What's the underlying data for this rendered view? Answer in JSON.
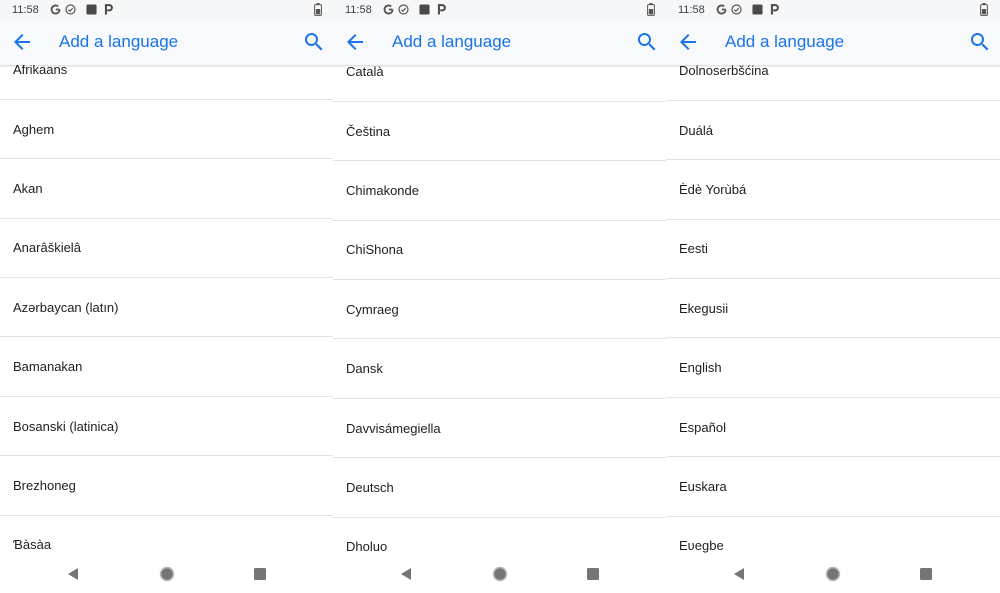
{
  "colors": {
    "accent": "#1a73e8",
    "text": "#202124",
    "icon_gray": "#757575",
    "divider": "#e3e3e3"
  },
  "screens": [
    {
      "status_bar": {
        "time": "11:58",
        "icons": [
          "google-icon",
          "circle-check-icon",
          "square-notification-icon",
          "p-icon"
        ],
        "battery": "battery-icon"
      },
      "app_bar": {
        "back_icon": "arrow-left-icon",
        "title": "Add a language",
        "search_icon": "search-icon"
      },
      "languages": [
        "Afrikaans",
        "Aghem",
        "Akan",
        "Anarâškielâ",
        "Azərbaycan (latın)",
        "Bamanakan",
        "Bosanski (latinica)",
        "Brezhoneg",
        "Ɓàsàa"
      ],
      "nav_bar": {
        "icons": [
          "back-triangle-icon",
          "home-circle-icon",
          "recents-square-icon"
        ]
      }
    },
    {
      "status_bar": {
        "time": "11:58",
        "icons": [
          "google-icon",
          "circle-check-icon",
          "square-notification-icon",
          "p-icon"
        ],
        "battery": "battery-icon"
      },
      "app_bar": {
        "back_icon": "arrow-left-icon",
        "title": "Add a language",
        "search_icon": "search-icon"
      },
      "languages": [
        "Català",
        "Čeština",
        "Chimakonde",
        "ChiShona",
        "Cymraeg",
        "Dansk",
        "Davvisámegiella",
        "Deutsch",
        "Dholuo"
      ],
      "nav_bar": {
        "icons": [
          "back-triangle-icon",
          "home-circle-icon",
          "recents-square-icon"
        ]
      }
    },
    {
      "status_bar": {
        "time": "11:58",
        "icons": [
          "google-icon",
          "circle-check-icon",
          "square-notification-icon",
          "p-icon"
        ],
        "battery": "battery-icon"
      },
      "app_bar": {
        "back_icon": "arrow-left-icon",
        "title": "Add a language",
        "search_icon": "search-icon"
      },
      "languages": [
        "Dolnoserbšćina",
        "Duálá",
        "Èdè Yorùbá",
        "Eesti",
        "Ekegusii",
        "English",
        "Español",
        "Euskara",
        "Eʋegbe"
      ],
      "nav_bar": {
        "icons": [
          "back-triangle-icon",
          "home-circle-icon",
          "recents-square-icon"
        ]
      }
    }
  ]
}
